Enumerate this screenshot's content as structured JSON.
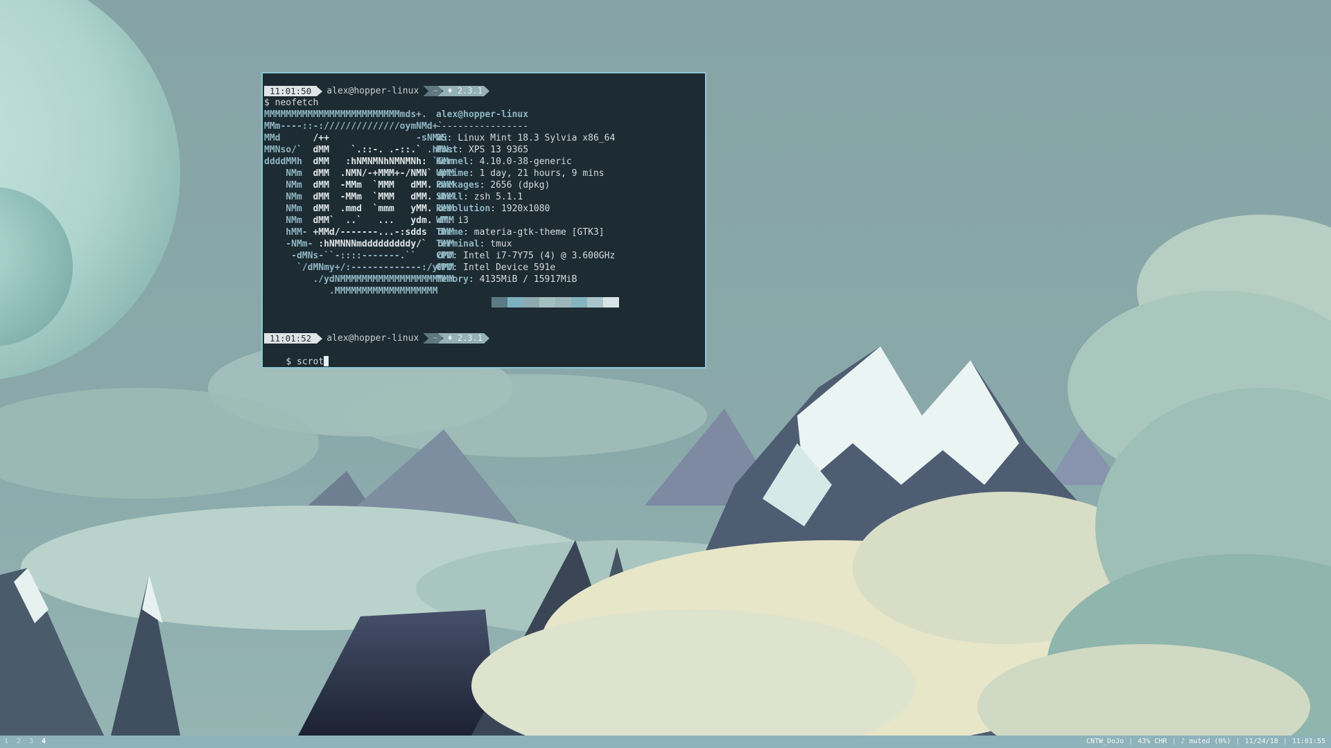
{
  "wallpaper": {
    "sky_color": "#86a4a5",
    "planet_color": "#b6dcd6",
    "moon_color": "#9ecdc7",
    "cloud_light": "#e9e7c8",
    "cloud_mid": "#a9c7c0",
    "mountain_dark": "#3d4b57",
    "mountain_snow": "#eef6f4"
  },
  "terminal": {
    "prompt1": {
      "time": "11:01:50",
      "user": "alex@hopper-linux",
      "dir": "~",
      "version": "♦ 2.3.1"
    },
    "command1": "$ neofetch",
    "logo_lines": [
      [
        {
          "t": "MMMMMMMMMMMMMMMMMMMMMMMMMmds+.",
          "c": 1
        }
      ],
      [
        {
          "t": "MMm----::-://////////////oymNMd+`",
          "c": 1
        }
      ],
      [
        {
          "t": "MMd      ",
          "c": 1
        },
        {
          "t": "/++                ",
          "c": 0
        },
        {
          "t": "-sNMd:",
          "c": 1
        }
      ],
      [
        {
          "t": "MMNso/`  ",
          "c": 1
        },
        {
          "t": "dMM    `.::-. .-::.` ",
          "c": 0
        },
        {
          "t": ".hMN:",
          "c": 1
        }
      ],
      [
        {
          "t": "ddddMMh  ",
          "c": 1
        },
        {
          "t": "dMM   :hNMNMNhNMNMNh: ",
          "c": 0
        },
        {
          "t": "`NMm",
          "c": 1
        }
      ],
      [
        {
          "t": "    NMm  ",
          "c": 1
        },
        {
          "t": "dMM  .NMN/-+MMM+-/NMN` ",
          "c": 0
        },
        {
          "t": "dMM",
          "c": 1
        }
      ],
      [
        {
          "t": "    NMm  ",
          "c": 1
        },
        {
          "t": "dMM  -MMm  `MMM   dMM. ",
          "c": 0
        },
        {
          "t": "dMM",
          "c": 1
        }
      ],
      [
        {
          "t": "    NMm  ",
          "c": 1
        },
        {
          "t": "dMM  -MMm  `MMM   dMM. ",
          "c": 0
        },
        {
          "t": "dMM",
          "c": 1
        }
      ],
      [
        {
          "t": "    NMm  ",
          "c": 1
        },
        {
          "t": "dMM  .mmd  `mmm   yMM. ",
          "c": 0
        },
        {
          "t": "dMM",
          "c": 1
        }
      ],
      [
        {
          "t": "    NMm  ",
          "c": 1
        },
        {
          "t": "dMM`  ..`   ...   ydm. ",
          "c": 0
        },
        {
          "t": "dMM",
          "c": 1
        }
      ],
      [
        {
          "t": "    hMM- ",
          "c": 1
        },
        {
          "t": "+MMd/-------...-:sdds  ",
          "c": 0
        },
        {
          "t": "dMM",
          "c": 1
        }
      ],
      [
        {
          "t": "    -NMm- ",
          "c": 1
        },
        {
          "t": ":hNMNNNmdddddddddy/`  ",
          "c": 0
        },
        {
          "t": "dMM",
          "c": 1
        }
      ],
      [
        {
          "t": "     -dMNs-``-::::-------.``    dMM",
          "c": 1
        }
      ],
      [
        {
          "t": "      `/dMNmy+/:-------------:/yMMM",
          "c": 1
        }
      ],
      [
        {
          "t": "         ./ydNMMMMMMMMMMMMMMMMMMMMM",
          "c": 1
        }
      ],
      [
        {
          "t": "            .MMMMMMMMMMMMMMMMMMM",
          "c": 1
        }
      ]
    ],
    "info_title": "alex@hopper-linux",
    "info_sep": "-----------------",
    "info": [
      {
        "k": "OS",
        "v": "Linux Mint 18.3 Sylvia x86_64"
      },
      {
        "k": "Host",
        "v": "XPS 13 9365"
      },
      {
        "k": "Kernel",
        "v": "4.10.0-38-generic"
      },
      {
        "k": "Uptime",
        "v": "1 day, 21 hours, 9 mins"
      },
      {
        "k": "Packages",
        "v": "2656 (dpkg)"
      },
      {
        "k": "Shell",
        "v": "zsh 5.1.1"
      },
      {
        "k": "Resolution",
        "v": "1920x1080"
      },
      {
        "k": "WM",
        "v": "i3"
      },
      {
        "k": "Theme",
        "v": "materia-gtk-theme [GTK3]"
      },
      {
        "k": "Terminal",
        "v": "tmux"
      },
      {
        "k": "CPU",
        "v": "Intel i7-7Y75 (4) @ 3.600GHz"
      },
      {
        "k": "GPU",
        "v": "Intel Device 591e"
      },
      {
        "k": "Memory",
        "v": "4135MiB / 15917MiB"
      }
    ],
    "palette": [
      "#5c7a86",
      "#7fb0c0",
      "#8eaab0",
      "#a4bfc0",
      "#9bb7b9",
      "#85b4c0",
      "#a9c6cb",
      "#d7e3e4"
    ],
    "prompt2": {
      "time": "11:01:52",
      "user": "alex@hopper-linux",
      "dir": "~",
      "version": "♦ 2.3.1"
    },
    "command2": "$ scrot"
  },
  "statusbar": {
    "workspaces": [
      {
        "label": "1",
        "active": false
      },
      {
        "label": "2",
        "active": false
      },
      {
        "label": "3",
        "active": false
      },
      {
        "label": "4",
        "active": true
      }
    ],
    "right_items": [
      "CNTW_DoJo",
      "43% CHR",
      "♪ muted (0%)",
      "11/24/18",
      "11:01:55"
    ],
    "separator": "|"
  }
}
